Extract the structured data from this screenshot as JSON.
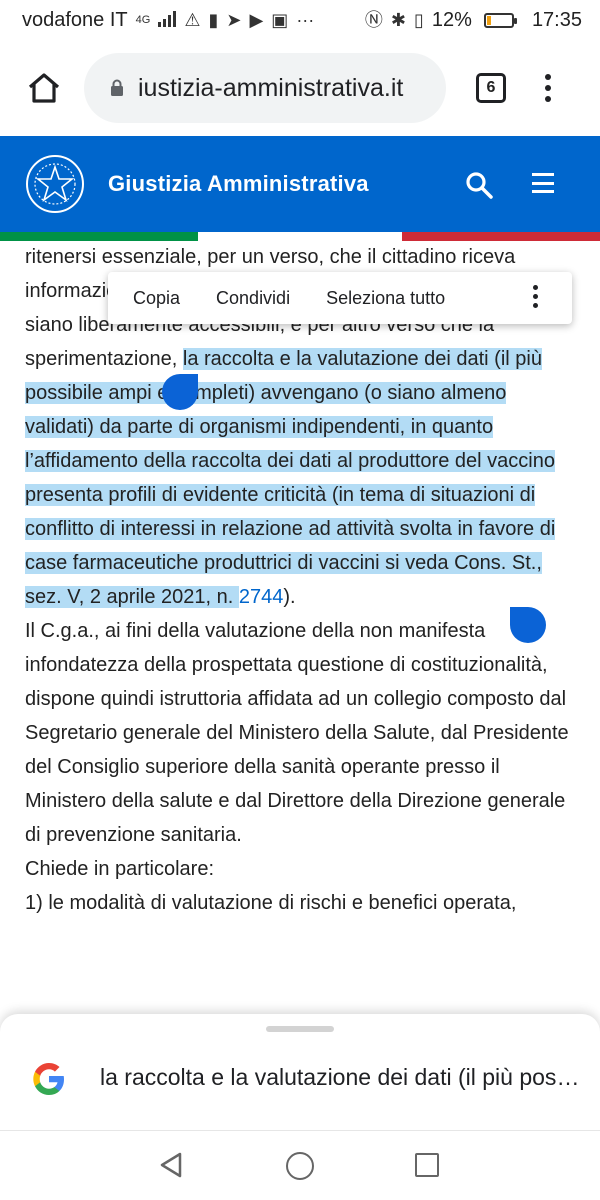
{
  "status_bar": {
    "carrier": "vodafone IT",
    "network": "4G",
    "battery_percent": "12%",
    "time": "17:35",
    "left_icons": [
      "signal-icon",
      "warning-icon",
      "battery-alert-icon",
      "telegram-icon",
      "youtube-icon",
      "app-icon",
      "more-icon"
    ],
    "right_icons": [
      "nfc-icon",
      "bluetooth-icon",
      "vibrate-icon"
    ]
  },
  "browser": {
    "url": "iustizia-amministrativa.it",
    "tab_count": "6"
  },
  "site": {
    "title": "Giustizia Amministrativa",
    "brand_color": "#0066cc"
  },
  "selection_toolbar": {
    "copy": "Copia",
    "share": "Condividi",
    "select_all": "Seleziona tutto"
  },
  "article": {
    "p1_unselected_start": "ritenersi essenziale, per un verso, che il cittadino riceva informazioni complete e corrette e, per altro verso, che i dati siano liberamente accessibili, e per altro verso che la sperimentazione, ",
    "p1_selected": "la raccolta e la valutazione dei dati (il più possibile ampi e completi) avvengano (o siano almeno validati) da parte di organismi indipendenti, in quanto l’affidamento della raccolta dei dati al produttore del vaccino presenta profili di evidente criticità (in tema di situazioni di conflitto di interessi in relazione ad attività svolta in favore di case farmaceutiche produttrici di vaccini si veda Cons. St., sez. V, 2 aprile 2021, n. ",
    "p1_link": "2744",
    "p1_end": ").",
    "p2": "Il C.g.a., ai fini della valutazione della non manifesta infondatezza della prospettata questione di costituzionalità, dispone quindi istruttoria affidata ad un collegio composto dal Segretario generale del Ministero della Salute, dal Presidente del Consiglio superiore della sanità operante presso il Ministero della salute e dal Direttore della Direzione generale di prevenzione sanitaria.",
    "p3": "Chiede in particolare:",
    "p4": "1) le modalità di valutazione di rischi e benefici operata,"
  },
  "bottom_sheet": {
    "query": "la raccolta e la valutazione dei dati (il più possibile ampi e completi)"
  },
  "colors": {
    "selection": "#b3dcf5",
    "handle": "#0b63d6",
    "flag_green": "#009246",
    "flag_red": "#ce2b37"
  }
}
